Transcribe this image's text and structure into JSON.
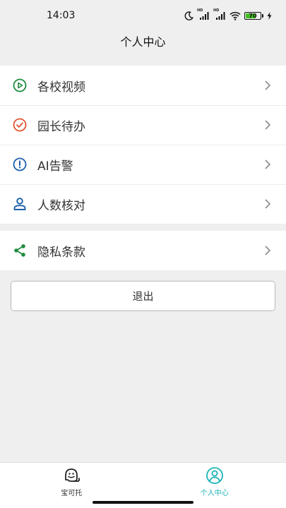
{
  "status_bar": {
    "time": "14:03",
    "battery": "70",
    "battery_level": 0.7,
    "signal_1_label": "HD",
    "signal_2_label": "HD"
  },
  "nav": {
    "title": "个人中心"
  },
  "menu": {
    "group1": [
      {
        "label": "各校视频",
        "icon": "play-circle-icon",
        "color": "#1f8a3f"
      },
      {
        "label": "园长待办",
        "icon": "check-circle-icon",
        "color": "#e0542f"
      },
      {
        "label": "AI告警",
        "icon": "alert-circle-icon",
        "color": "#1a5fa8"
      },
      {
        "label": "人数核对",
        "icon": "person-icon",
        "color": "#1a5fa8"
      }
    ],
    "group2": [
      {
        "label": "隐私条款",
        "icon": "share-icon",
        "color": "#1f8a3f"
      }
    ]
  },
  "logout": {
    "label": "退出"
  },
  "tabs": [
    {
      "label": "宝可托",
      "icon": "baby-face-icon",
      "active": false
    },
    {
      "label": "个人中心",
      "icon": "user-circle-icon",
      "active": true
    }
  ],
  "colors": {
    "accent": "#19b3b6",
    "background": "#efefef"
  }
}
